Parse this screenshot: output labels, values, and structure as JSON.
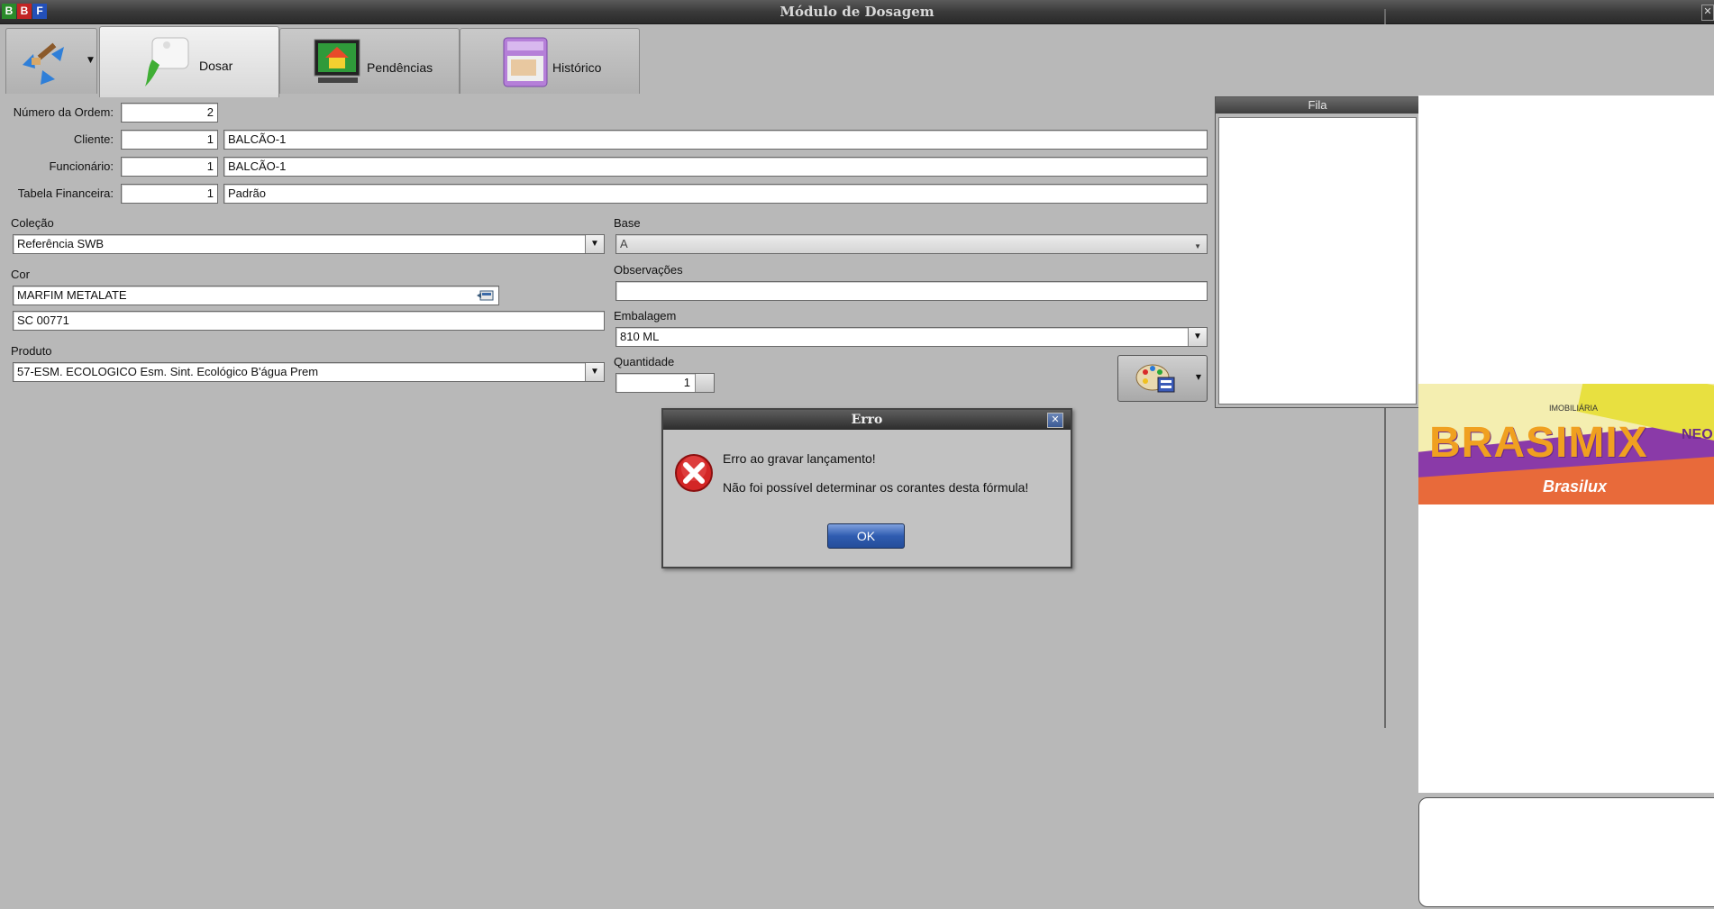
{
  "window": {
    "title": "Módulo de Dosagem",
    "logo_letters": [
      "B",
      "B",
      "F"
    ],
    "close_glyph": "✕"
  },
  "tabs": [
    {
      "label": "Dosar",
      "icon": "paint-drop-icon",
      "active": true
    },
    {
      "label": "Pendências",
      "icon": "monitor-house-icon",
      "active": false
    },
    {
      "label": "Histórico",
      "icon": "archive-drawer-icon",
      "active": false
    }
  ],
  "form": {
    "ordem_label": "Número da Ordem:",
    "ordem_value": "2",
    "cliente_label": "Cliente:",
    "cliente_code": "1",
    "cliente_name": "BALCÃO-1",
    "funcionario_label": "Funcionário:",
    "funcionario_code": "1",
    "funcionario_name": "BALCÃO-1",
    "tabela_label": "Tabela Financeira:",
    "tabela_code": "1",
    "tabela_name": "Padrão",
    "colecao_label": "Coleção",
    "colecao_value": "Referência SWB",
    "base_label": "Base",
    "base_value": "A",
    "cor_label": "Cor",
    "cor_name": "MARFIM METALATE",
    "cor_code": "SC 00771",
    "observacoes_label": "Observações",
    "observacoes_value": "",
    "embalagem_label": "Embalagem",
    "embalagem_value": "810 ML",
    "produto_label": "Produto",
    "produto_value": "57-ESM. ECOLOGICO Esm. Sint. Ecológico B'água Prem",
    "quantidade_label": "Quantidade",
    "quantidade_value": "1"
  },
  "fila": {
    "title": "Fila"
  },
  "banner": {
    "top_text": "IMOBILIÁRIA",
    "brand": "BRASIMIX",
    "brand_suffix": "NEO",
    "sub_brand": "Brasilux"
  },
  "dialog": {
    "title": "Erro",
    "line1": "Erro ao gravar lançamento!",
    "line2": "Não foi possível determinar os corantes desta fórmula!",
    "ok_label": "OK",
    "icon": "error-x-icon"
  },
  "colors": {
    "background": "#b8b8b8",
    "titlebar": "#3a3a3a",
    "ok_button": "#2f5cb0",
    "error_red": "#d32626"
  }
}
